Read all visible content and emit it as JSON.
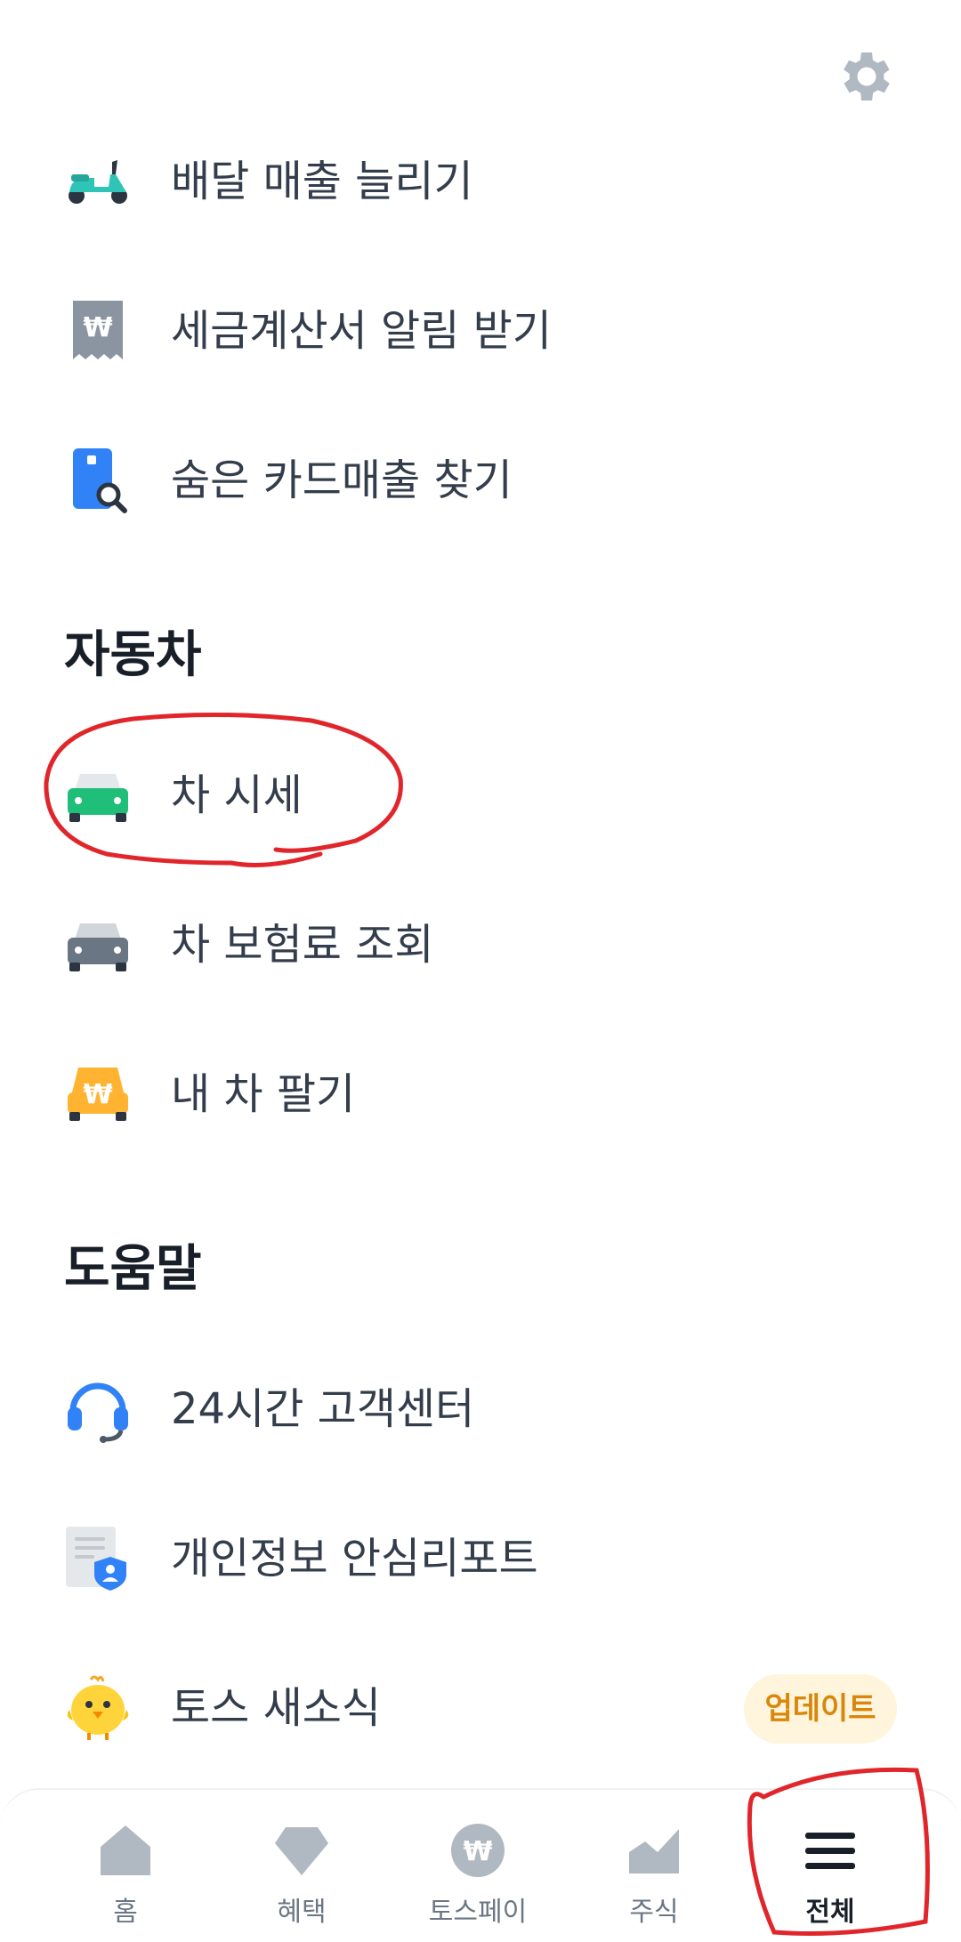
{
  "menu_items": [
    {
      "label": "배달 매출 늘리기",
      "icon": "scooter-icon"
    },
    {
      "label": "세금계산서 알림 받기",
      "icon": "receipt-won-icon"
    },
    {
      "label": "숨은 카드매출 찾기",
      "icon": "card-search-icon"
    },
    {
      "label": "차 시세",
      "icon": "green-car-icon"
    },
    {
      "label": "차 보험료 조회",
      "icon": "gray-car-icon"
    },
    {
      "label": "내 차 팔기",
      "icon": "won-car-icon"
    },
    {
      "label": "24시간 고객센터",
      "icon": "headset-icon"
    },
    {
      "label": "개인정보 안심리포트",
      "icon": "privacy-shield-icon"
    },
    {
      "label": "토스 새소식",
      "icon": "chick-icon",
      "badge": "업데이트"
    }
  ],
  "sections": {
    "car": "자동차",
    "help": "도움말"
  },
  "tabs": [
    {
      "label": "홈",
      "icon": "home-icon"
    },
    {
      "label": "혜택",
      "icon": "diamond-icon"
    },
    {
      "label": "토스페이",
      "icon": "won-coin-icon"
    },
    {
      "label": "주식",
      "icon": "stock-chart-icon"
    },
    {
      "label": "전체",
      "icon": "menu-icon",
      "active": true
    }
  ],
  "colors": {
    "accent_green": "#1fbf7a",
    "badge_text": "#d9870a",
    "badge_bg": "#fff4dc",
    "annotation_red": "#e0262b"
  }
}
